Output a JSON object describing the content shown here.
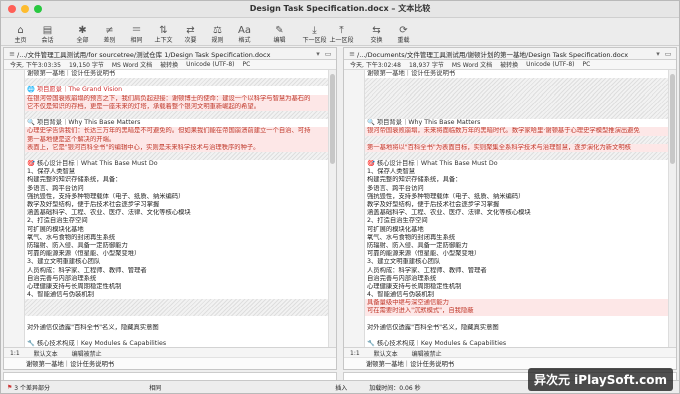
{
  "window": {
    "title": "Design Task Specification.docx – 文本比较",
    "traffic": [
      "#ff5f57",
      "#febc2e",
      "#28c840"
    ]
  },
  "toolbar": [
    {
      "icon": "⌂",
      "label": "主页",
      "name": "home"
    },
    {
      "icon": "▤",
      "label": "会话",
      "name": "session"
    },
    {
      "icon": "✱",
      "label": "全部",
      "name": "all"
    },
    {
      "icon": "≠",
      "label": "差别",
      "name": "diffs"
    },
    {
      "icon": "＝",
      "label": "相同",
      "name": "same"
    },
    {
      "icon": "⇅",
      "label": "上下文",
      "name": "context"
    },
    {
      "icon": "⇄",
      "label": "次要",
      "name": "minor"
    },
    {
      "icon": "⚖",
      "label": "规则",
      "name": "rules"
    },
    {
      "icon": "Aa",
      "label": "格式",
      "name": "format"
    },
    {
      "icon": "✎",
      "label": "编辑",
      "name": "edit"
    },
    {
      "icon": "⤓",
      "label": "下一区段",
      "name": "next-section"
    },
    {
      "icon": "⤒",
      "label": "上一区段",
      "name": "prev-section"
    },
    {
      "icon": "⇆",
      "label": "交换",
      "name": "swap"
    },
    {
      "icon": "⟳",
      "label": "重载",
      "name": "reload"
    }
  ],
  "left": {
    "path": "/.../文件管理工具测试用/for sourcetree/测试仓库 1/Design Task Specification.docx",
    "info": [
      "今天, 下午3:03:35",
      "19,150 字节",
      "MS Word 文档",
      "被转换",
      "Unicode (UTF-8)",
      "PC"
    ],
    "lines": [
      {
        "t": "谢顿第一基地｜设计任务说明书",
        "k": "head"
      },
      {
        "t": "",
        "k": "hatch"
      },
      {
        "t": "🌐 项目愿景｜The Grand Vision",
        "k": "red"
      },
      {
        "t": "在银河帝国衰败崩塌的预言之下，我们肩负起迎接：谢顿博士的使命：建设一个以科学与智慧为基石的",
        "k": "changed"
      },
      {
        "t": "它不仅是知识的存档，更是一座未来的灯塔，承载着整个银河文明重新崛起的希望。",
        "k": "changed"
      },
      {
        "t": "",
        "k": "hatch"
      },
      {
        "t": "🔍 项目背景｜Why This Base Matters",
        "k": "head"
      },
      {
        "t": "心理史学告诉我们：长达三万年的黑暗是不可避免的。但如果我们能在帝国崩溃前建立一个自治、可持",
        "k": "changed"
      },
      {
        "t": "第一基地便是这个解决的开端。",
        "k": "changed"
      },
      {
        "t": "表面上，它是\"银河百科全书\"的编辑中心，实则是未来科学技术与治理秩序的种子。",
        "k": "changed"
      },
      {
        "t": "",
        "k": "hatch"
      },
      {
        "t": "🎯 核心设计目标｜What This Base Must Do",
        "k": "head"
      },
      {
        "t": "1、保存人类智慧",
        "k": ""
      },
      {
        "t": "构建完整的知识存储系统，具备：",
        "k": ""
      },
      {
        "t": "多语言、跨平台访问",
        "k": ""
      },
      {
        "t": "强抗毁性，支持多种物理载体（电子、纸质、纳米编码）",
        "k": ""
      },
      {
        "t": "教学及好型结构，便于后技术社会逐步学习掌握",
        "k": ""
      },
      {
        "t": "涵盖基础科学、工程、农业、医疗、法律、文化等核心模块",
        "k": ""
      },
      {
        "t": "2、打造自治生存空间",
        "k": ""
      },
      {
        "t": "可扩展的模块化基地",
        "k": ""
      },
      {
        "t": "氧气、水与食物的封闭再生系统",
        "k": ""
      },
      {
        "t": "防辐射、防入侵、具备一定防御能力",
        "k": ""
      },
      {
        "t": "可靠的能源来源（恒星能、小型聚变堆）",
        "k": ""
      },
      {
        "t": "3、建立文明重建核心团队",
        "k": ""
      },
      {
        "t": "人员构成：科学家、工程师、教师、管理者",
        "k": ""
      },
      {
        "t": "自治完善与内部治理系统",
        "k": ""
      },
      {
        "t": "心理健康支持与长周期稳定性机制",
        "k": ""
      },
      {
        "t": "4、智能通信与伪装机制",
        "k": ""
      },
      {
        "t": "",
        "k": "hatch"
      },
      {
        "t": "",
        "k": "hatch"
      },
      {
        "t": "",
        "k": ""
      },
      {
        "t": "对外通信仅透露\"百科全书\"名义，隐藏真实意图",
        "k": ""
      },
      {
        "t": "",
        "k": ""
      },
      {
        "t": "🔧 核心技术构成｜Key Modules & Capabilities",
        "k": "head"
      },
      {
        "t": "模块分类",
        "k": ""
      },
      {
        "t": "关键要素",
        "k": ""
      }
    ],
    "pos": [
      "1:1",
      "默认文本",
      "编辑被禁止"
    ],
    "lower": "谢顿第一基地｜设计任务说明书"
  },
  "right": {
    "path": "/.../Documents/文件管理工具测试用/谢顿计划的第一基地/Design Task Specification.docx",
    "info": [
      "今天, 下午3:02:48",
      "18,937 字节",
      "MS Word 文档",
      "被转换",
      "Unicode (UTF-8)",
      "PC"
    ],
    "lines": [
      {
        "t": "谢顿第一基地｜设计任务说明书",
        "k": "head"
      },
      {
        "t": "",
        "k": "hatch"
      },
      {
        "t": "",
        "k": "hatch"
      },
      {
        "t": "",
        "k": "hatch"
      },
      {
        "t": "",
        "k": "hatch"
      },
      {
        "t": "",
        "k": "hatch"
      },
      {
        "t": "🔍 项目背景｜Why This Base Matters",
        "k": "head"
      },
      {
        "t": "银河帝国衰败崩塌，未来将面临数万年的黑暗时代。数学家哈里·谢顿基于心理史学模型推演出避免",
        "k": "changed"
      },
      {
        "t": "",
        "k": "hatch"
      },
      {
        "t": "第一基地将以\"百科全书\"为表面目标，实则聚集全系科学技术与治理智慧，逐步演化为新文明核",
        "k": "changed"
      },
      {
        "t": "",
        "k": "hatch"
      },
      {
        "t": "🎯 核心设计目标｜What This Base Must Do",
        "k": "head"
      },
      {
        "t": "1、保存人类智慧",
        "k": ""
      },
      {
        "t": "构建完整的知识存储系统，具备：",
        "k": ""
      },
      {
        "t": "多语言、跨平台访问",
        "k": ""
      },
      {
        "t": "强抗毁性，支持多种物理载体（电子、纸质、纳米编码）",
        "k": ""
      },
      {
        "t": "教学及好型结构，便于后技术社会逐步学习掌握",
        "k": ""
      },
      {
        "t": "涵盖基础科学、工程、农业、医疗、法律、文化等核心模块",
        "k": ""
      },
      {
        "t": "2、打造自治生存空间",
        "k": ""
      },
      {
        "t": "可扩展的模块化基地",
        "k": ""
      },
      {
        "t": "氧气、水与食物的封闭再生系统",
        "k": ""
      },
      {
        "t": "防辐射、防入侵、具备一定防御能力",
        "k": ""
      },
      {
        "t": "可靠的能源来源（恒星能、小型聚变堆）",
        "k": ""
      },
      {
        "t": "3、建立文明重建核心团队",
        "k": ""
      },
      {
        "t": "人员构成：科学家、工程师、教师、管理者",
        "k": ""
      },
      {
        "t": "自治完善与内部治理系统",
        "k": ""
      },
      {
        "t": "心理健康支持与长周期稳定性机制",
        "k": ""
      },
      {
        "t": "4、智能通信与伪装机制",
        "k": ""
      },
      {
        "t": "具备量级中继与深空通信能力",
        "k": "changed"
      },
      {
        "t": "可在需要时进入\"沉默模式\"，自我隐蔽",
        "k": "changed"
      },
      {
        "t": "",
        "k": ""
      },
      {
        "t": "对外通信仅透露\"百科全书\"名义，隐藏真实意图",
        "k": ""
      },
      {
        "t": "",
        "k": ""
      },
      {
        "t": "🔧 核心技术构成｜Key Modules & Capabilities",
        "k": "head"
      },
      {
        "t": "模块分类",
        "k": ""
      },
      {
        "t": "关键要素",
        "k": ""
      }
    ],
    "pos": [
      "1:1",
      "默认文本",
      "编辑被禁止"
    ],
    "lower": "谢顿第一基地｜设计任务说明书"
  },
  "status": {
    "diffs": "3 个差异部分",
    "same": "相同",
    "mode": "插入",
    "load": "加载时间：0.06 秒"
  },
  "watermark": "异次元 iPlaySoft.com"
}
